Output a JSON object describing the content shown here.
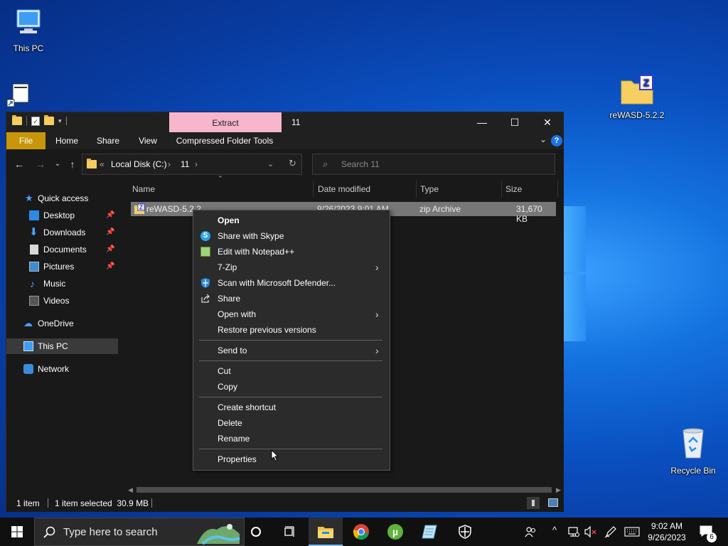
{
  "desktop": {
    "icons": [
      {
        "label": "This PC"
      },
      {
        "label": "reWASD-5.2.2"
      },
      {
        "label": "Recycle Bin"
      }
    ]
  },
  "window": {
    "title": "11",
    "contextual_tab_header": "Extract",
    "ribbon_tabs": [
      "File",
      "Home",
      "Share",
      "View",
      "Compressed Folder Tools"
    ],
    "controls": {
      "minimize": "—",
      "maximize": "☐",
      "close": "✕"
    },
    "address": {
      "root": "«",
      "drive": "Local Disk (C:)",
      "folder": "11"
    },
    "search_placeholder": "Search 11",
    "nav_pane": [
      {
        "label": "Quick access"
      },
      {
        "label": "Desktop"
      },
      {
        "label": "Downloads"
      },
      {
        "label": "Documents"
      },
      {
        "label": "Pictures"
      },
      {
        "label": "Music"
      },
      {
        "label": "Videos"
      },
      {
        "label": "OneDrive"
      },
      {
        "label": "This PC"
      },
      {
        "label": "Network"
      }
    ],
    "columns": [
      "Name",
      "Date modified",
      "Type",
      "Size"
    ],
    "files": [
      {
        "name": "reWASD-5.2.2",
        "date": "9/26/2023 9:01 AM",
        "type": "zip Archive",
        "size": "31,670 KB"
      }
    ],
    "status": {
      "items": "1 item",
      "selected": "1 item selected  30.9 MB"
    }
  },
  "context_menu": {
    "items": [
      "Open",
      "Share with Skype",
      "Edit with Notepad++",
      "7-Zip",
      "Scan with Microsoft Defender...",
      "Share",
      "Open with",
      "Restore previous versions",
      "Send to",
      "Cut",
      "Copy",
      "Create shortcut",
      "Delete",
      "Rename",
      "Properties"
    ]
  },
  "taskbar": {
    "search_placeholder": "Type here to search",
    "time": "9:02 AM",
    "date": "9/26/2023",
    "notification_count": "6"
  },
  "colors": {
    "file_tab": "#c8960a",
    "contextual_tab": "#f7b6cc",
    "accent": "#76b9ed"
  }
}
